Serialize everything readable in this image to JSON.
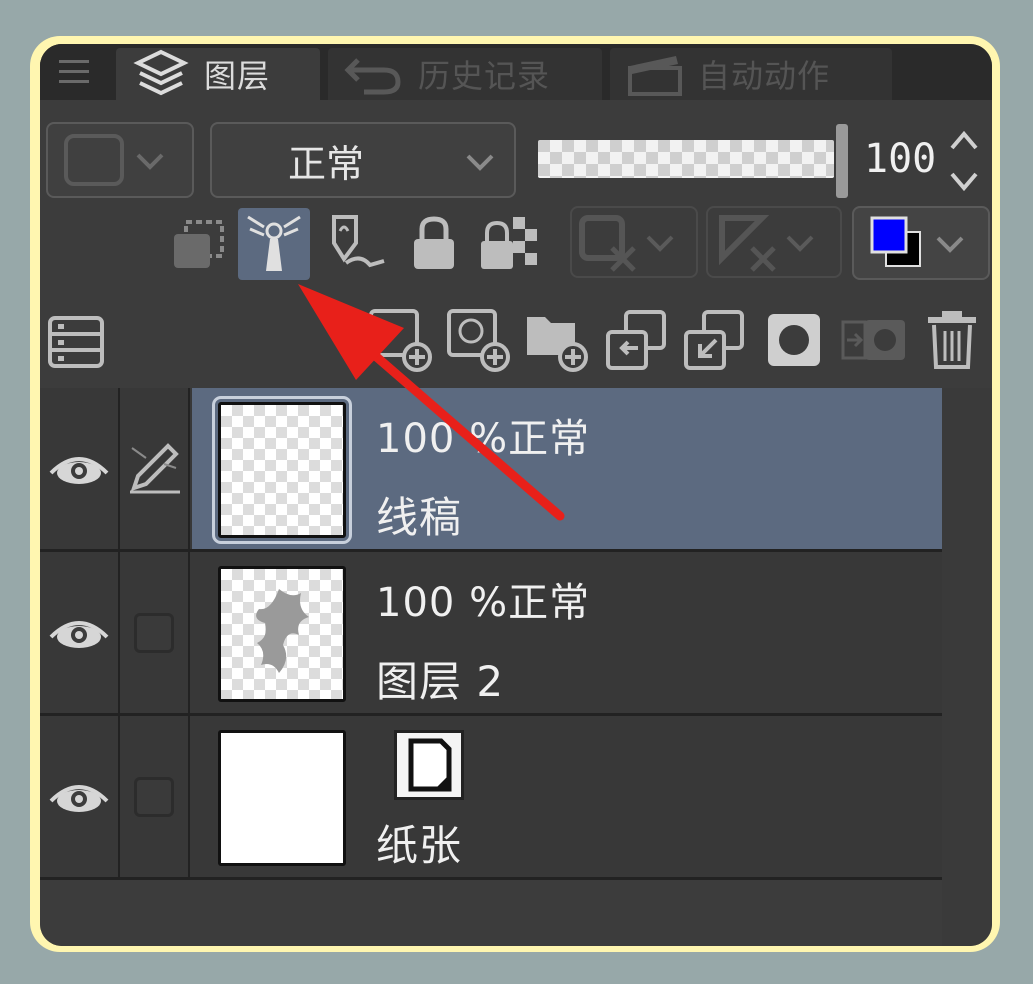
{
  "tabs": [
    {
      "label": "图层",
      "icon": "layers-icon",
      "active": true
    },
    {
      "label": "历史记录",
      "icon": "undo-icon",
      "active": false
    },
    {
      "label": "自动动作",
      "icon": "clapper-icon",
      "active": false
    }
  ],
  "toolbar": {
    "blend_mode": "正常",
    "opacity_value": "100"
  },
  "row2_icons": [
    "clip-to-layer-below-icon",
    "reference-layer-icon",
    "draft-layer-icon",
    "lock-icon",
    "lock-transparency-icon",
    "mask-toggle-icon",
    "ruler-toggle-icon",
    "layer-color-icon"
  ],
  "row3_icons": [
    "layer-property-icon",
    "new-raster-layer-icon",
    "new-vector-layer-icon",
    "new-folder-icon",
    "transfer-down-icon",
    "merge-down-icon",
    "create-mask-icon",
    "apply-mask-icon",
    "delete-layer-icon"
  ],
  "layers": [
    {
      "meta": "100 %正常",
      "name": "线稿",
      "selected": true
    },
    {
      "meta": "100 %正常",
      "name": "图层 2",
      "selected": false
    },
    {
      "meta": "",
      "name": "纸张",
      "selected": false
    }
  ],
  "colors": {
    "frame": "#fff6b0",
    "background": "#97a8a9",
    "panel": "#3c3c3c",
    "selected_row": "#5c6a80",
    "arrow": "#e8201a",
    "main_color": "#0000ff",
    "sub_color": "#000000"
  }
}
